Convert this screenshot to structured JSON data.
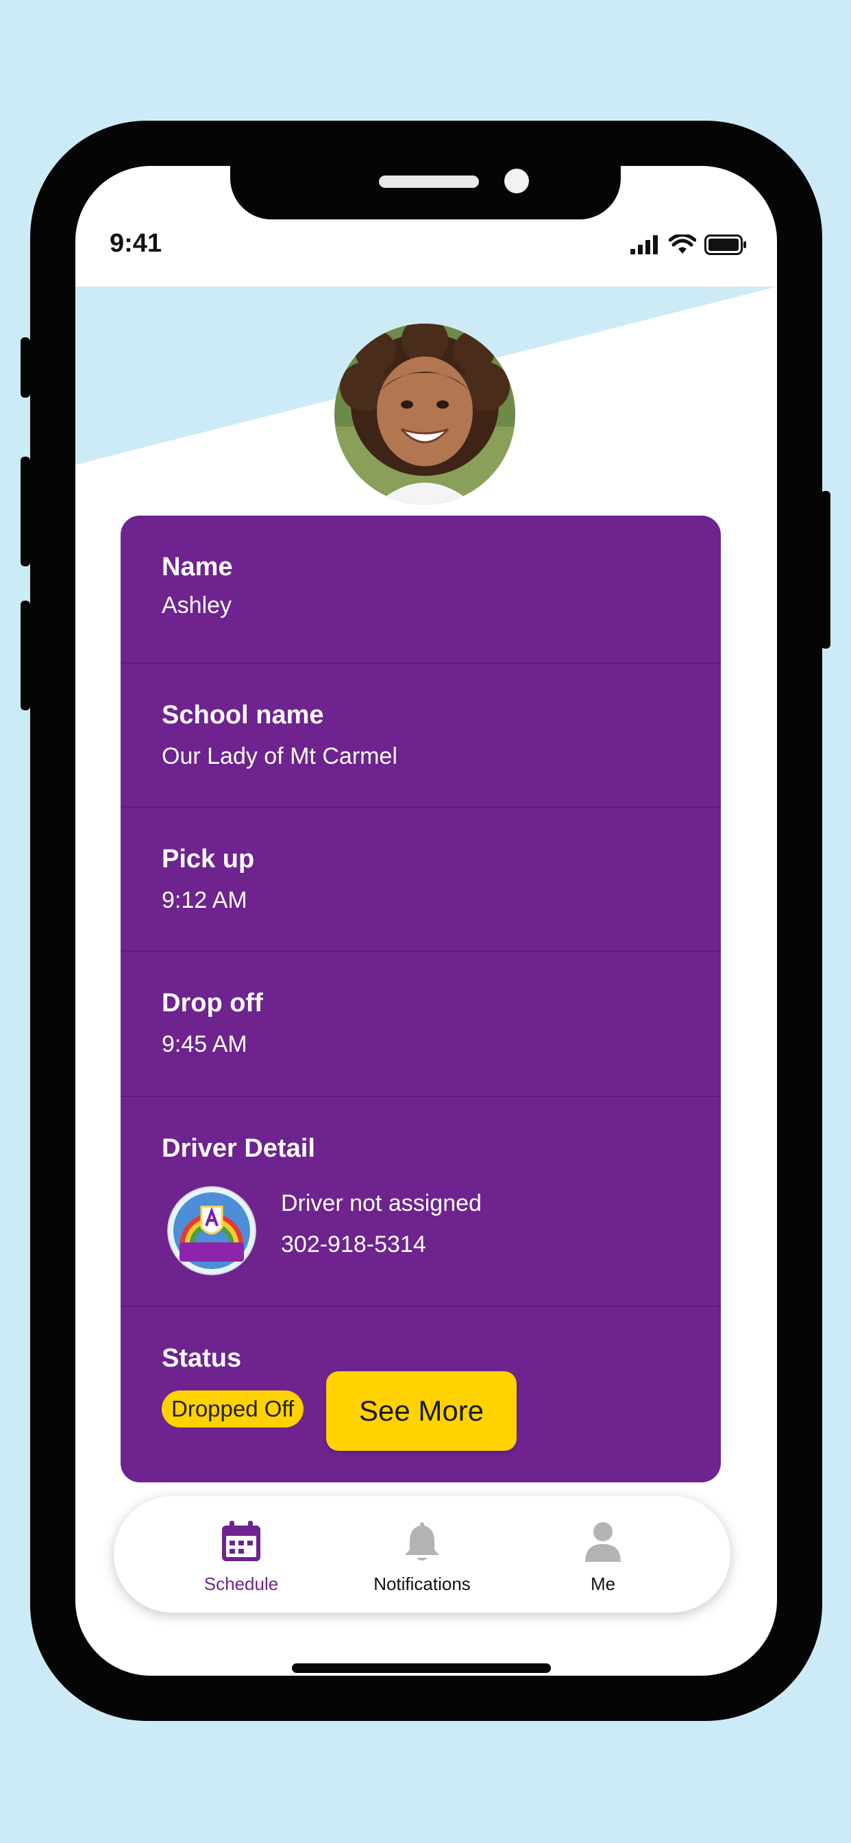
{
  "status_bar": {
    "time": "9:41"
  },
  "profile": {
    "name_label": "Name",
    "name": "Ashley",
    "school_label": "School name",
    "school": "Our Lady of Mt Carmel",
    "pickup_label": "Pick up",
    "pickup_time": "9:12 AM",
    "dropoff_label": "Drop off",
    "dropoff_time": "9:45 AM",
    "driver_label": "Driver Detail",
    "driver_name": "Driver not assigned",
    "driver_phone": "302-918-5314",
    "status_label": "Status",
    "status_value": "Dropped Off"
  },
  "actions": {
    "see_more": "See More"
  },
  "tabs": [
    {
      "label": "Schedule",
      "icon": "calendar-icon",
      "active": true
    },
    {
      "label": "Notifications",
      "icon": "bell-icon",
      "active": false
    },
    {
      "label": "Me",
      "icon": "person-icon",
      "active": false
    }
  ],
  "colors": {
    "background": "#cdebf6",
    "card": "#6e238f",
    "accent": "#ffd200",
    "active_tab": "#6e238f",
    "inactive_icon": "#b3b3b3"
  }
}
